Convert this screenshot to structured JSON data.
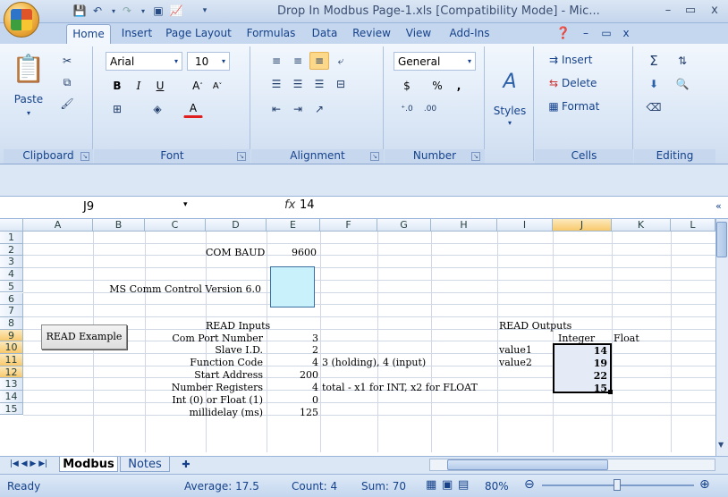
{
  "window": {
    "title": "Drop In Modbus Page-1.xls  [Compatibility Mode] - Mic..."
  },
  "ribbon": {
    "tabs": [
      "Home",
      "Insert",
      "Page Layout",
      "Formulas",
      "Data",
      "Review",
      "View",
      "Add-Ins"
    ],
    "clipboard": {
      "label": "Clipboard",
      "paste": "Paste"
    },
    "font": {
      "label": "Font",
      "name": "Arial",
      "size": "10",
      "bold": "B",
      "italic": "I",
      "underline": "U"
    },
    "alignment": {
      "label": "Alignment"
    },
    "number": {
      "label": "Number",
      "format": "General",
      "currency": "$",
      "percent": "%",
      "comma": ","
    },
    "styles": {
      "label": "Styles"
    },
    "cells": {
      "label": "Cells",
      "insert": "Insert",
      "delete": "Delete",
      "format": "Format"
    },
    "editing": {
      "label": "Editing"
    }
  },
  "formula_bar": {
    "name_box": "J9",
    "fx": "fx",
    "value": "14"
  },
  "grid": {
    "columns": [
      "A",
      "B",
      "C",
      "D",
      "E",
      "F",
      "G",
      "H",
      "I",
      "J",
      "K",
      "L"
    ],
    "rows": [
      "1",
      "2",
      "3",
      "4",
      "5",
      "6",
      "7",
      "8",
      "9",
      "10",
      "11",
      "12",
      "13",
      "14",
      "15"
    ],
    "cells": {
      "D2": "COM BAUD",
      "E2": "9600",
      "C5": "MS Comm Control Version 6.0",
      "D7": "READ Inputs",
      "I7": "READ Outputs",
      "D8": "Com Port Number",
      "E8": "3",
      "J8": "Integer",
      "K8": "Float",
      "D9": "Slave I.D.",
      "E9": "2",
      "I9": "value1",
      "J9": "14",
      "D10": "Function Code",
      "E10": "4",
      "F10": "3 (holding), 4 (input)",
      "I10": "value2",
      "J10": "19",
      "D11": "Start Address",
      "E11": "200",
      "J11": "22",
      "D12": "Number Registers",
      "E12": "4",
      "F12": "total - x1 for INT, x2 for FLOAT",
      "J12": "15",
      "D13": "Int (0) or Float (1)",
      "E13": "0",
      "D14": "millidelay (ms)",
      "E14": "125"
    },
    "read_button": "READ Example"
  },
  "sheets": [
    "Modbus",
    "Notes"
  ],
  "status": {
    "ready": "Ready",
    "average": "Average: 17.5",
    "count": "Count: 4",
    "sum": "Sum: 70",
    "zoom": "80%"
  }
}
